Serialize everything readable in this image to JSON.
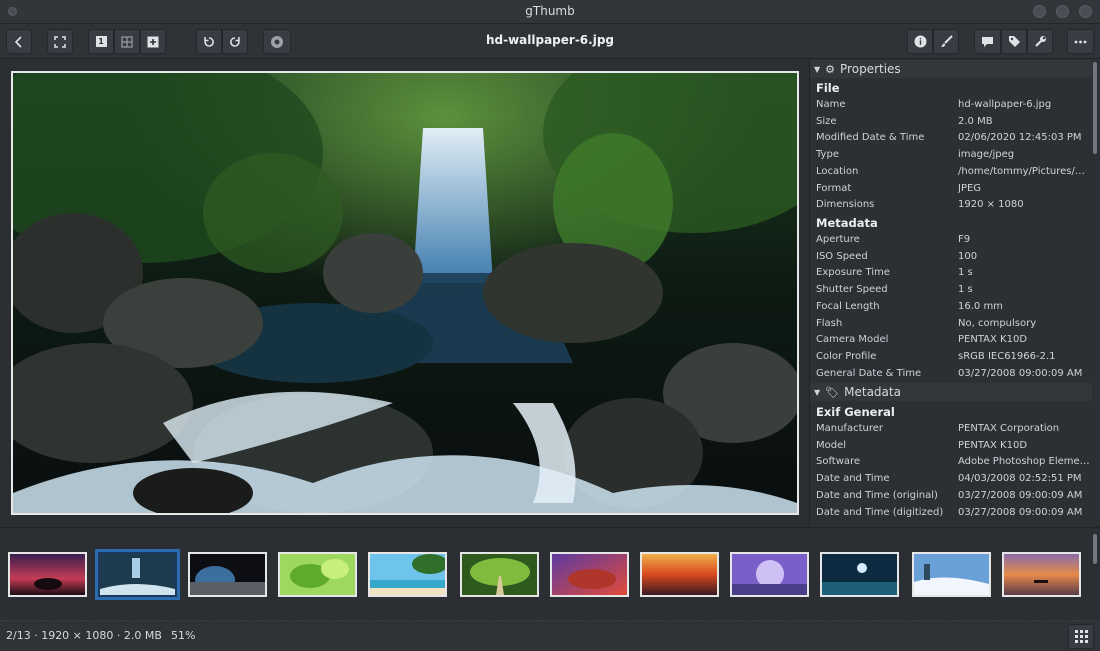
{
  "window": {
    "title": "gThumb"
  },
  "toolbar": {
    "filename": "hd-wallpaper-6.jpg",
    "view_single_label": "1"
  },
  "properties": {
    "header": "Properties",
    "file_title": "File",
    "file_rows": [
      {
        "key": "Name",
        "value": "hd-wallpaper-6.jpg"
      },
      {
        "key": "Size",
        "value": "2.0 MB"
      },
      {
        "key": "Modified Date & Time",
        "value": "02/06/2020 12:45:03 PM"
      },
      {
        "key": "Type",
        "value": "image/jpeg"
      },
      {
        "key": "Location",
        "value": "/home/tommy/Pictures/gTh..."
      },
      {
        "key": "Format",
        "value": "JPEG"
      },
      {
        "key": "Dimensions",
        "value": "1920 × 1080"
      }
    ],
    "meta_title": "Metadata",
    "meta_rows": [
      {
        "key": "Aperture",
        "value": "F9"
      },
      {
        "key": "ISO Speed",
        "value": "100"
      },
      {
        "key": "Exposure Time",
        "value": "1 s"
      },
      {
        "key": "Shutter Speed",
        "value": "1 s"
      },
      {
        "key": "Focal Length",
        "value": "16.0 mm"
      },
      {
        "key": "Flash",
        "value": "No, compulsory"
      },
      {
        "key": "Camera Model",
        "value": "PENTAX K10D"
      },
      {
        "key": "Color Profile",
        "value": "sRGB IEC61966-2.1"
      },
      {
        "key": "General Date & Time",
        "value": "03/27/2008 09:00:09 AM"
      }
    ]
  },
  "metadata": {
    "header": "Metadata",
    "exif_title": "Exif General",
    "exif_rows": [
      {
        "key": "Manufacturer",
        "value": "PENTAX Corporation"
      },
      {
        "key": "Model",
        "value": "PENTAX K10D"
      },
      {
        "key": "Software",
        "value": "Adobe Photoshop Elements ..."
      },
      {
        "key": "Date and Time",
        "value": "04/03/2008 02:52:51 PM"
      },
      {
        "key": "Date and Time (original)",
        "value": "03/27/2008 09:00:09 AM"
      },
      {
        "key": "Date and Time (digitized)",
        "value": "03/27/2008 09:00:09 AM"
      }
    ]
  },
  "status": {
    "info": "2/13  ·  1920 × 1080  ·  2.0 MB",
    "zoom": "51%"
  },
  "colors": {
    "accent": "#2b6cb0",
    "background": "#2b2e33"
  }
}
